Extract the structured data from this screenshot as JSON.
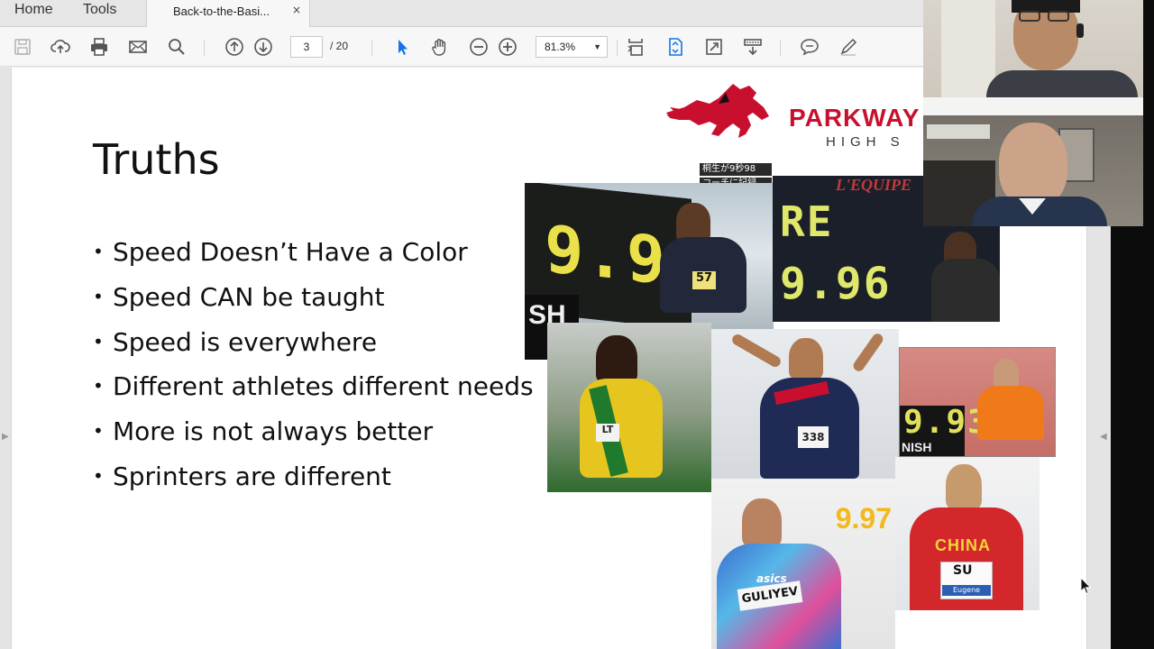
{
  "tabbar": {
    "home": "Home",
    "tools": "Tools",
    "doc_tab": "Back-to-the-Basi...",
    "close_glyph": "×"
  },
  "toolbar": {
    "current_page": "3",
    "page_total": "/ 20",
    "zoom": "81.3%",
    "icons": [
      "save-icon",
      "upload-icon",
      "print-icon",
      "email-icon",
      "search-icon",
      "prev-page-icon",
      "next-page-icon",
      "select-cursor-icon",
      "hand-icon",
      "zoom-out-icon",
      "zoom-in-icon",
      "scroll-mode-icon",
      "fit-page-icon",
      "full-screen-icon",
      "read-mode-icon",
      "comment-icon",
      "sign-icon"
    ],
    "accent": "#1473e6"
  },
  "slide": {
    "title": "Truths",
    "bullets": [
      "Speed Doesn’t Have a Color",
      "Speed CAN be taught",
      "Speed is everywhere",
      "Different athletes different needs",
      "More is not always better",
      "Sprinters are different"
    ],
    "logo": {
      "line1": "PARKWAY",
      "line2": "HIGH S",
      "color": "#c8102e"
    },
    "photo_texts": {
      "jp_line1": "桐生が9秒98",
      "jp_line2": "コーチに記録",
      "board1": "9.98",
      "board1_brand": "SH",
      "bib1": "57",
      "lequipe": "L'EQUIPE",
      "board2_top": "RE",
      "board2": "9.96",
      "bib_bolt": "LT",
      "bib_gemili": "338",
      "board3": "9.93",
      "board3_brand": "NISH",
      "time_guliyev": "9.97",
      "bib_guliyev": "GULIYEV",
      "brand_guliyev": "asics",
      "china": "CHINA",
      "bib_su": "SU",
      "bib_su_sub": "Eugene"
    }
  }
}
